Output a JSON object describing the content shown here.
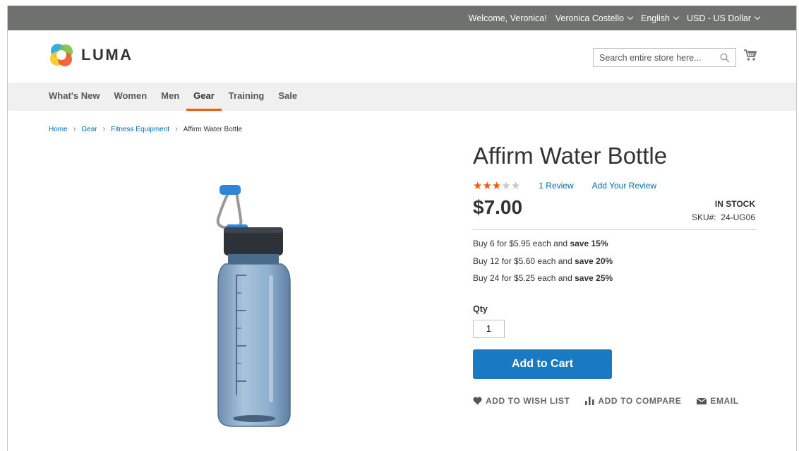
{
  "topbar": {
    "welcome": "Welcome, Veronica!",
    "account": "Veronica Costello",
    "language": "English",
    "currency": "USD - US Dollar"
  },
  "header": {
    "logo_text": "LUMA",
    "search_placeholder": "Search entire store here..."
  },
  "nav": {
    "items": [
      "What's New",
      "Women",
      "Men",
      "Gear",
      "Training",
      "Sale"
    ],
    "active": "Gear"
  },
  "breadcrumbs": {
    "home": "Home",
    "gear": "Gear",
    "fitness": "Fitness Equipment",
    "current": "Affirm Water Bottle"
  },
  "product": {
    "name": "Affirm Water Bottle",
    "rating": 3,
    "rating_max": 5,
    "reviews_label": "1 Review",
    "add_review_label": "Add Your Review",
    "price": "$7.00",
    "stock": "IN STOCK",
    "sku_label": "SKU#:",
    "sku_value": "24-UG06",
    "tiers": [
      {
        "text": "Buy 6 for $5.95 each and ",
        "save": "save 15%"
      },
      {
        "text": "Buy 12 for $5.60 each and ",
        "save": "save 20%"
      },
      {
        "text": "Buy 24 for $5.25 each and ",
        "save": "save 25%"
      }
    ],
    "qty_label": "Qty",
    "qty_value": "1",
    "add_to_cart": "Add to Cart",
    "wishlist": "ADD TO WISH LIST",
    "compare": "ADD TO COMPARE",
    "email": "EMAIL"
  },
  "colors": {
    "topbar": "#6e716e",
    "accent": "#ff5501",
    "button": "#1979c3",
    "link": "#006bb4"
  },
  "icons": [
    "chevron-down-icon",
    "search-icon",
    "cart-icon",
    "heart-icon",
    "compare-icon",
    "envelope-icon"
  ]
}
